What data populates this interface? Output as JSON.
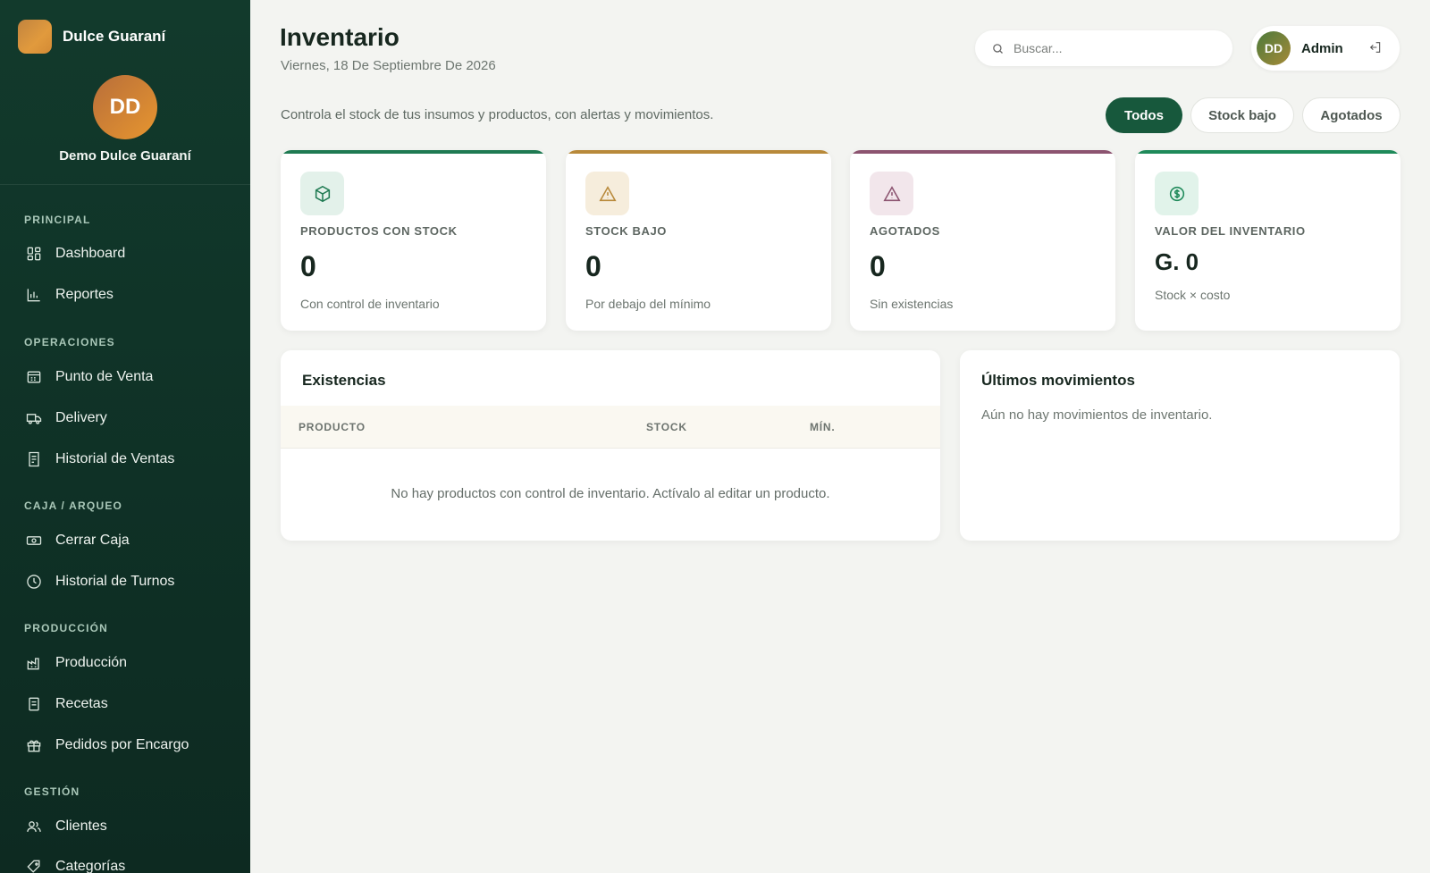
{
  "app": {
    "name": "Dulce Guaraní"
  },
  "profile": {
    "initials": "DD",
    "name": "Demo Dulce Guaraní"
  },
  "sidebar": {
    "sections": [
      {
        "title": "PRINCIPAL",
        "items": [
          {
            "label": "Dashboard",
            "icon": "dashboard-icon"
          },
          {
            "label": "Reportes",
            "icon": "bar-chart-icon"
          }
        ]
      },
      {
        "title": "OPERACIONES",
        "items": [
          {
            "label": "Punto de Venta",
            "icon": "register-icon"
          },
          {
            "label": "Delivery",
            "icon": "truck-icon"
          },
          {
            "label": "Historial de Ventas",
            "icon": "receipt-icon"
          }
        ]
      },
      {
        "title": "CAJA / ARQUEO",
        "items": [
          {
            "label": "Cerrar Caja",
            "icon": "cash-icon"
          },
          {
            "label": "Historial de Turnos",
            "icon": "clock-icon"
          }
        ]
      },
      {
        "title": "PRODUCCIÓN",
        "items": [
          {
            "label": "Producción",
            "icon": "factory-icon"
          },
          {
            "label": "Recetas",
            "icon": "recipe-icon"
          },
          {
            "label": "Pedidos por Encargo",
            "icon": "gift-icon"
          }
        ]
      },
      {
        "title": "GESTIÓN",
        "items": [
          {
            "label": "Clientes",
            "icon": "users-icon"
          },
          {
            "label": "Categorías",
            "icon": "tag-icon"
          }
        ]
      }
    ]
  },
  "header": {
    "title": "Inventario",
    "date": "Viernes, 18 De Septiembre De 2026",
    "search_placeholder": "Buscar...",
    "user_initials": "DD",
    "user_name": "Admin"
  },
  "subtitle": "Controla el stock de tus insumos y productos, con alertas y movimientos.",
  "filters": {
    "todos": "Todos",
    "stock_bajo": "Stock bajo",
    "agotados": "Agotados",
    "active": "Todos"
  },
  "stats": [
    {
      "label": "PRODUCTOS CON STOCK",
      "value": "0",
      "note": "Con control de inventario",
      "color": "#1f7a52",
      "icon": "box-icon"
    },
    {
      "label": "STOCK BAJO",
      "value": "0",
      "note": "Por debajo del mínimo",
      "color": "#b8893a",
      "icon": "warning-icon"
    },
    {
      "label": "AGOTADOS",
      "value": "0",
      "note": "Sin existencias",
      "color": "#8c5470",
      "icon": "warning-icon"
    },
    {
      "label": "VALOR DEL INVENTARIO",
      "value": "G. 0",
      "note": "Stock × costo",
      "color": "#1f8a5a",
      "icon": "coin-icon"
    }
  ],
  "existencias": {
    "title": "Existencias",
    "columns": {
      "producto": "PRODUCTO",
      "stock": "STOCK",
      "min": "MÍN."
    },
    "empty": "No hay productos con control de inventario. Actívalo al editar un producto."
  },
  "movimientos": {
    "title": "Últimos movimientos",
    "empty": "Aún no hay movimientos de inventario."
  },
  "colors": {
    "primary": "#17583c",
    "sidebar": "#0f3126",
    "background": "#f3f4f1"
  }
}
